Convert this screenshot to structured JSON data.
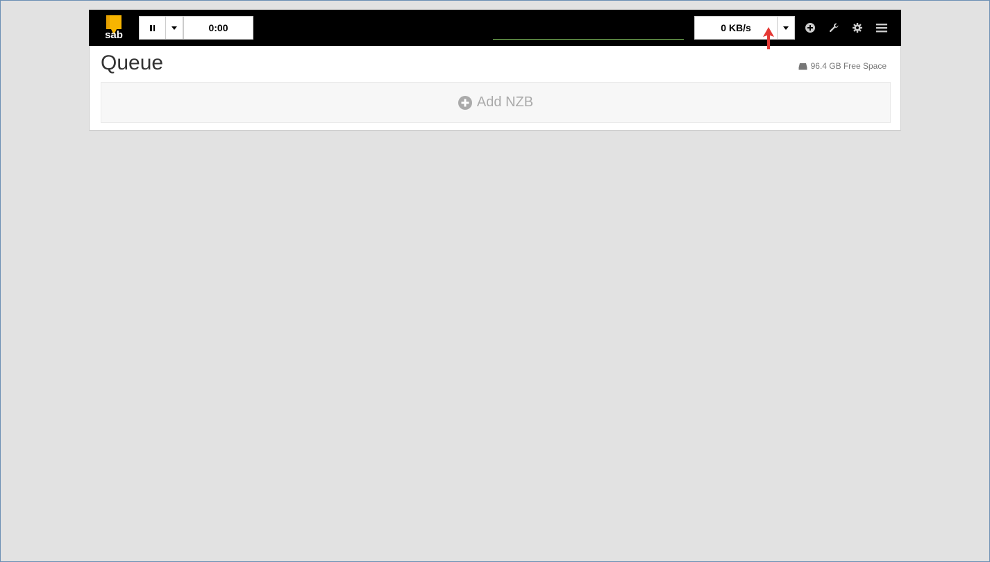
{
  "navbar": {
    "logo_text": "sab",
    "pause_icon": "pause-icon",
    "time_remaining": "0:00",
    "speed": "0 KB/s",
    "icons": [
      "plus-circle-icon",
      "wrench-icon",
      "gear-icon",
      "hamburger-menu-icon"
    ]
  },
  "queue": {
    "title": "Queue",
    "free_space": "96.4 GB Free Space",
    "add_nzb_label": "Add NZB"
  },
  "colors": {
    "navbar_bg": "#000000",
    "page_bg": "#e2e2e2",
    "logo_yellow": "#f7b500",
    "annotation_arrow": "#e53935",
    "progress_line": "#7fbf5c"
  }
}
